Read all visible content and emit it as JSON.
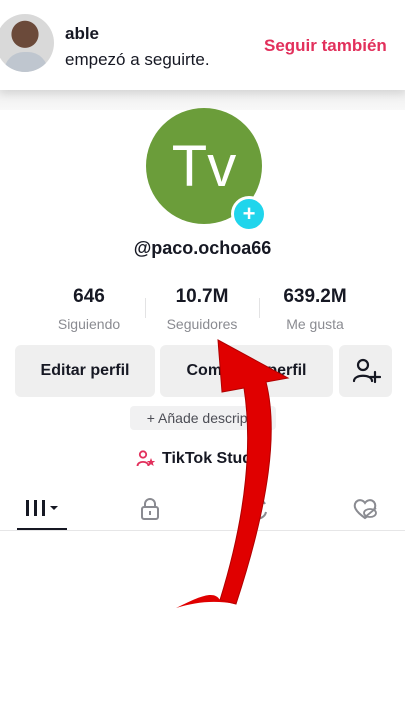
{
  "notification": {
    "name": "able",
    "message": "empezó a seguirte.",
    "follow_back": "Seguir también"
  },
  "profile": {
    "avatar_initials": "Tv",
    "username": "@paco.ochoa66",
    "stats": [
      {
        "value": "646",
        "label": "Siguiendo"
      },
      {
        "value": "10.7M",
        "label": "Seguidores"
      },
      {
        "value": "639.2M",
        "label": "Me gusta"
      }
    ],
    "edit_button": "Editar perfil",
    "share_button": "Compartir perfil",
    "add_bio": "+ Añade descrip...",
    "studio": "TikTok Studio"
  },
  "colors": {
    "accent": "#e2305c",
    "avatar_bg": "#6b9d3a",
    "plus_badge": "#20d5ec",
    "arrow": "#e00000"
  },
  "icons": {
    "add_friend": "person-plus-icon",
    "videos_tab": "grid-icon",
    "private_tab": "lock-icon",
    "reposts_tab": "repost-icon",
    "liked_tab": "heart-eye-off-icon"
  }
}
